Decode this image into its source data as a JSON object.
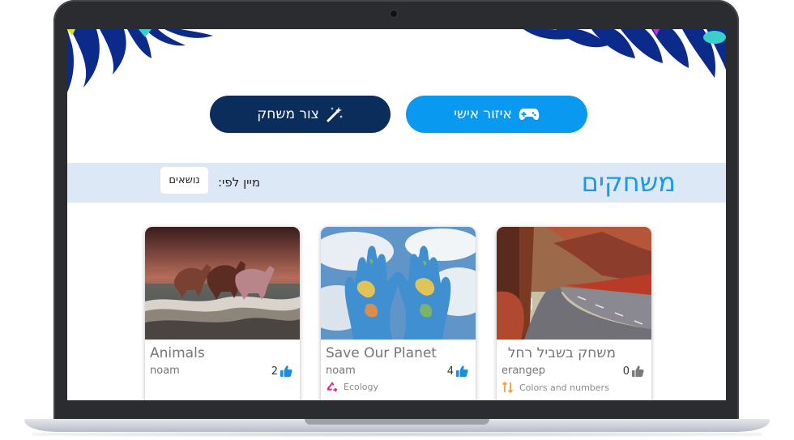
{
  "header": {
    "personal_area_button": "איזור אישי",
    "create_game_button": "צור משחק"
  },
  "games_section": {
    "title": "משחקים",
    "sort_label": "מיין לפי:",
    "sort_option": "נושאים"
  },
  "cards": [
    {
      "title": "Animals",
      "author": "noam",
      "likes": "2",
      "like_color": "#1a8fe0",
      "category": "",
      "image": "horses-icon"
    },
    {
      "title": "Save Our Planet",
      "author": "noam",
      "likes": "4",
      "like_color": "#1a8fe0",
      "category": "Ecology",
      "category_icon": "recycle-icon",
      "category_color": "#e0258a",
      "image": "globe-hands-icon"
    },
    {
      "title": "משחק בשביל רחל",
      "author": "erangep",
      "likes": "0",
      "like_color": "#7a7a7a",
      "category": "Colors and numbers",
      "category_icon": "numbers-icon",
      "category_color": "#f2a43a",
      "image": "forest-road-icon"
    }
  ],
  "colors": {
    "primary_dark": "#0b2d5c",
    "primary_light": "#0a99f0",
    "title_blue": "#1b9ae5",
    "sortbar_bg": "#dde8f7"
  }
}
